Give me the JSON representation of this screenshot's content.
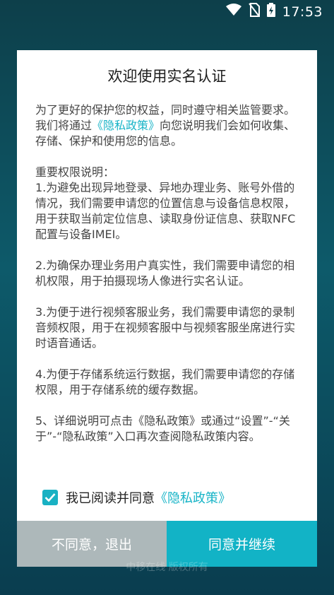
{
  "status_bar": {
    "time": "17:53",
    "icons": [
      "wifi-icon",
      "no-sim-icon",
      "battery-charging-icon"
    ]
  },
  "dialog": {
    "title": "欢迎使用实名认证",
    "intro_prefix": "为了更好的保护您的权益，同时遵守相关监管要求。我们将通过",
    "intro_link": "《隐私政策》",
    "intro_suffix": "向您说明我们会如何收集、存储、保护和使用您的信息。",
    "permissions_heading": "重要权限说明：",
    "item1": "1.为避免出现异地登录、异地办理业务、账号外借的情况，我们需要申请您的位置信息与设备信息权限，用于获取当前定位信息、读取身份证信息、获取NFC配置与设备IMEI。",
    "item2": "2.为确保办理业务用户真实性，我们需要申请您的相机权限，用于拍摄现场人像进行实名认证。",
    "item3": "3.为便于进行视频客服业务，我们需要申请您的录制音频权限，用于在视频客服中与视频客服坐席进行实时语音通话。",
    "item4": "4.为便于存储系统运行数据，我们需要申请您的存储权限，用于存储系统的缓存数据。",
    "item5": "5、详细说明可点击《隐私政策》或通过“设置”-“关于”-“隐私政策”入口再次查阅隐私政策内容。",
    "agree_prefix": "我已阅读并同意",
    "agree_link": "《隐私政策》",
    "agree_checked": true,
    "disagree_button": "不同意，退出",
    "agree_button": "同意并继续"
  },
  "footer": {
    "text": "中移在线 版权所有"
  },
  "colors": {
    "accent": "#12b3c6",
    "disagree": "#adb8ba",
    "link": "#18b4c7"
  }
}
